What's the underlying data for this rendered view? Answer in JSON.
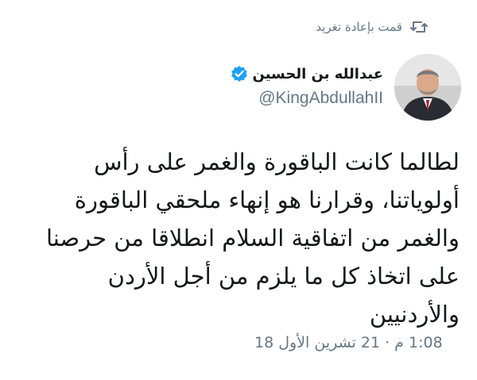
{
  "retweet": {
    "label": "قمت بإعادة تغريد",
    "icon": "retweet-icon"
  },
  "author": {
    "display_name": "عبدالله بن الحسين",
    "handle": "@KingAbdullahII",
    "verified": true,
    "verified_color": "#1da1f2",
    "avatar": "avatar-photo"
  },
  "tweet": {
    "text": "لطالما كانت الباقورة والغمر على رأس\nأولوياتنا، وقرارنا هو إنهاء ملحقي الباقورة\nوالغمر من اتفاقية السلام انطلاقا من حرصنا\nعلى اتخاذ كل ما يلزم من أجل الأردن\nوالأردنيين",
    "timestamp": "1:08 م · 21 تشرين الأول 18"
  },
  "colors": {
    "text": "#14171a",
    "secondary": "#657786",
    "background": "#ffffff"
  }
}
